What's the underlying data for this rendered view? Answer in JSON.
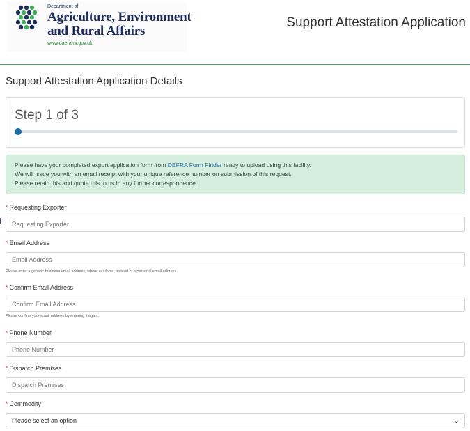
{
  "header": {
    "dept_line": "Department of",
    "name_line1": "Agriculture, Environment",
    "name_line2": "and Rural Affairs",
    "website": "www.daera-ni.gov.uk",
    "app_title": "Support Attestation Application"
  },
  "page": {
    "title": "Support Attestation Application Details"
  },
  "step": {
    "label": "Step 1 of 3",
    "progress": 0.0
  },
  "info": {
    "line1_prefix": "Please have your completed export application form from ",
    "line1_link": "DEFRA Form Finder",
    "line1_suffix": " ready to upload using this facility.",
    "line2": "We will issue you with an email receipt with your unique reference number on submission of this request.",
    "line3": "Please retain this and quote this to us in any further correspondence."
  },
  "form": {
    "required_mark": "*",
    "exporter": {
      "label": "Requesting Exporter",
      "placeholder": "Requesting Exporter"
    },
    "email": {
      "label": "Email Address",
      "placeholder": "Email Address",
      "help": "Please enter a generic business email address, where available, instead of a personal email address."
    },
    "confirm_email": {
      "label": "Confirm Email Address",
      "placeholder": "Confirm Email Address",
      "help": "Please confirm your email address by entering it again."
    },
    "phone": {
      "label": "Phone Number",
      "placeholder": "Phone Number"
    },
    "dispatch": {
      "label": "Dispatch Premises",
      "placeholder": "Dispatch Premises"
    },
    "commodity": {
      "label": "Commodity",
      "selected": "Please select an option",
      "icon": "chevron-down-icon"
    }
  },
  "colors": {
    "accent_green": "#3fae5a",
    "info_bg": "#d6eedd",
    "progress_blue": "#1a6aa6",
    "required_red": "#d9534f"
  }
}
